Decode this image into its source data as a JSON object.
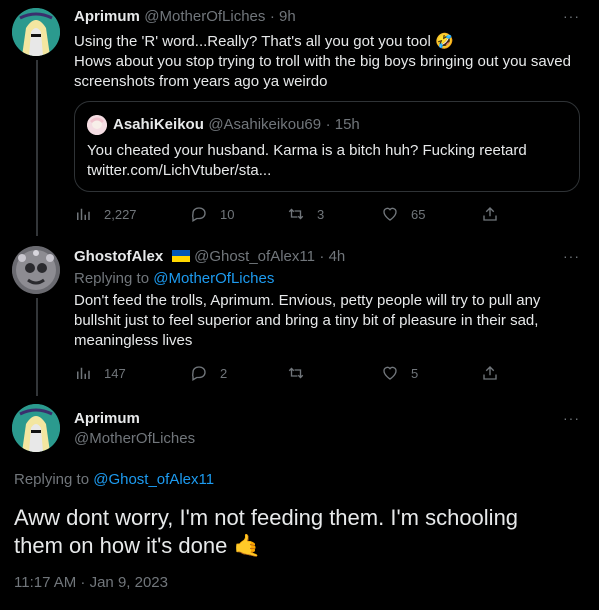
{
  "tweets": [
    {
      "display_name": "Aprimum",
      "handle": "@MotherOfLiches",
      "time": "· 9h",
      "text_line1": "Using the 'R' word...Really? That's all you got you tool 🤣",
      "text_line2": "Hows about you stop trying to troll with the big boys bringing out you saved",
      "text_line3": "screenshots from years ago ya weirdo",
      "quote": {
        "display_name": "AsahiKeikou",
        "handle": "@Asahikeikou69",
        "time": "· 15h",
        "text": "You cheated your husband. Karma is a bitch huh? Fucking reetard",
        "link": "twitter.com/LichVtuber/sta..."
      },
      "stats": {
        "views": "2,227",
        "replies": "10",
        "retweets": "3",
        "likes": "65"
      }
    },
    {
      "display_name": "GhostofAlex",
      "handle": "@Ghost_ofAlex11",
      "time": "· 4h",
      "replying_prefix": "Replying to",
      "replying_to": "@MotherOfLiches",
      "text_line1": "Don't feed the trolls, Aprimum. Envious, petty people will try to pull any",
      "text_line2": "bullshit just to feel superior and bring a tiny bit of pleasure in their sad,",
      "text_line3": "meaningless lives",
      "stats": {
        "views": "147",
        "replies": "2",
        "retweets": "",
        "likes": "5"
      }
    }
  ],
  "main_tweet": {
    "display_name": "Aprimum",
    "handle": "@MotherOfLiches",
    "replying_prefix": "Replying to",
    "replying_to": "@Ghost_ofAlex11",
    "text_line1": "Aww dont worry, I'm not feeding them. I'm schooling",
    "text_line2": "them on how it's done 🤙",
    "timestamp": "11:17 AM · Jan 9, 2023"
  },
  "more_label": "···"
}
